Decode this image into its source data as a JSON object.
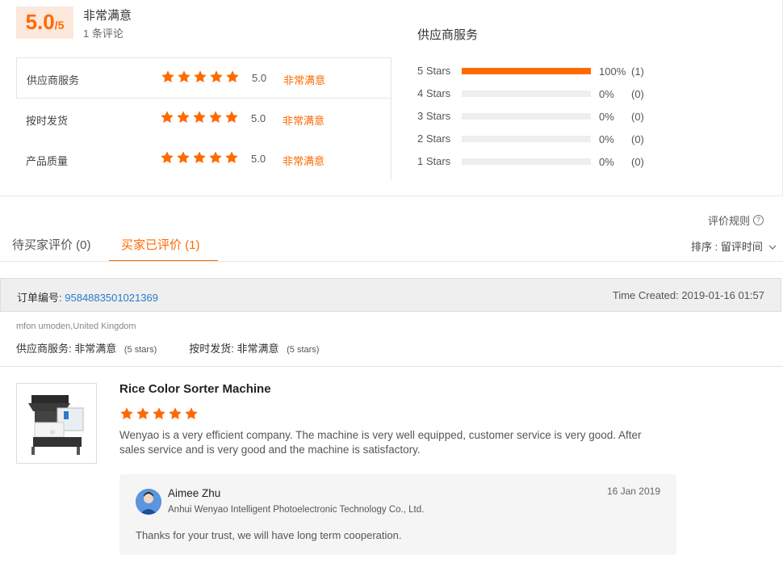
{
  "summary": {
    "score": "5.0",
    "score_max": "/5",
    "overall_label": "非常满意",
    "review_count": "1 条评论",
    "ratings": [
      {
        "label": "供应商服务",
        "score": "5.0",
        "text": "非常满意",
        "stars": 5
      },
      {
        "label": "按时发货",
        "score": "5.0",
        "text": "非常满意",
        "stars": 5
      },
      {
        "label": "产品质量",
        "score": "5.0",
        "text": "非常满意",
        "stars": 5
      }
    ]
  },
  "distribution": {
    "title": "供应商服务",
    "rows": [
      {
        "label": "5 Stars",
        "pct": "100%",
        "count": "(1)",
        "fill": 1.0
      },
      {
        "label": "4 Stars",
        "pct": "0%",
        "count": "(0)",
        "fill": 0
      },
      {
        "label": "3 Stars",
        "pct": "0%",
        "count": "(0)",
        "fill": 0
      },
      {
        "label": "2 Stars",
        "pct": "0%",
        "count": "(0)",
        "fill": 0
      },
      {
        "label": "1 Stars",
        "pct": "0%",
        "count": "(0)",
        "fill": 0
      }
    ]
  },
  "tabs": {
    "rules": "评价规则",
    "pending": "待买家评价 (0)",
    "reviewed": "买家已评价 (1)",
    "sort": "排序 : 留评时间"
  },
  "order": {
    "label": "订单编号:",
    "number": "9584883501021369",
    "time_created": "Time Created: 2019-01-16 01:57"
  },
  "buyer": {
    "name": "mfon umoden,United Kingdom",
    "service_label": "供应商服务:",
    "service_value": "非常满意",
    "service_stars": "(5 stars)",
    "delivery_label": "按时发货:",
    "delivery_value": "非常满意",
    "delivery_stars": "(5 stars)"
  },
  "review": {
    "product_title": "Rice Color Sorter Machine",
    "stars": 5,
    "text": "Wenyao is a very efficient company. The machine is very well equipped, customer service is very good. After sales service and is very good and the machine is satisfactory."
  },
  "reply": {
    "name": "Aimee Zhu",
    "company": "Anhui Wenyao Intelligent Photoelectronic Technology Co., Ltd.",
    "date": "16 Jan 2019",
    "text": "Thanks for your trust, we will have long term cooperation."
  },
  "colors": {
    "accent": "#ff6a00",
    "link": "#2b7bcb"
  }
}
